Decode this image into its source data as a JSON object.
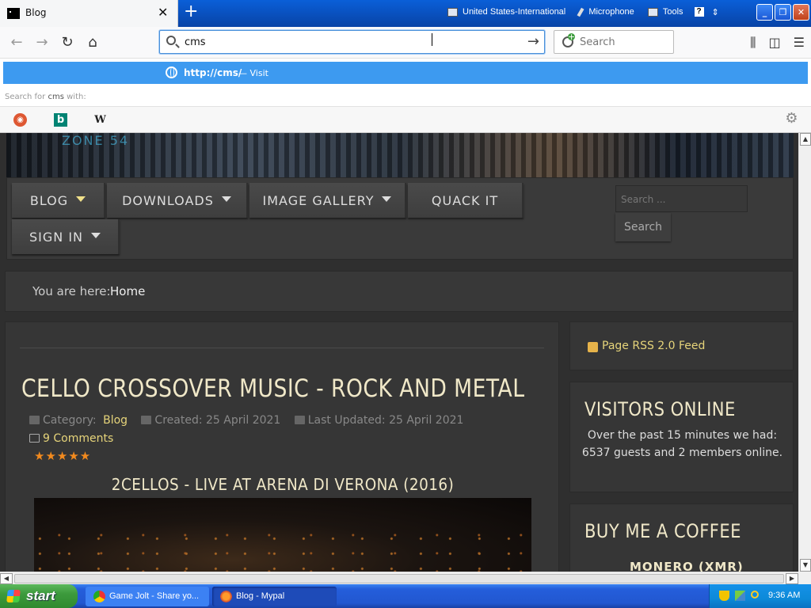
{
  "browser": {
    "tab_title": "Blog",
    "url_value": "cms",
    "search_placeholder": "Search",
    "suggestion_url": "http://cms/",
    "suggestion_action": "— Visit",
    "search_for_prefix": "Search for",
    "search_for_term": "cms",
    "search_for_suffix": "with:"
  },
  "language_bar": {
    "language": "United States-International",
    "microphone": "Microphone",
    "tools": "Tools",
    "help": "?"
  },
  "site": {
    "banner_text": "ZONE 54",
    "menu": {
      "blog": "BLOG",
      "downloads": "DOWNLOADS",
      "image_gallery": "IMAGE GALLERY",
      "quack_it": "QUACK IT",
      "sign_in": "SIGN IN"
    },
    "search_placeholder": "Search ...",
    "search_button": "Search",
    "breadcrumb_label": "You are here:",
    "breadcrumb_home": "Home"
  },
  "article": {
    "title": "CELLO CROSSOVER MUSIC - ROCK AND METAL",
    "category_label": "Category:",
    "category": "Blog",
    "created": "Created: 25 April 2021",
    "updated": "Last Updated: 25 April 2021",
    "comments": "9 Comments",
    "rating": "★★★★★",
    "rating_value": 5,
    "video_title": "2CELLOS - LIVE AT ARENA DI VERONA (2016)"
  },
  "sidebar": {
    "rss": "Page RSS 2.0 Feed",
    "visitors_title": "VISITORS ONLINE",
    "visitors_text": "Over the past 15 minutes we had: 6537 guests and 2 members online.",
    "coffee_title": "BUY ME A COFFEE",
    "coffee_sub": "MONERO (XMR)"
  },
  "taskbar": {
    "start": "start",
    "task1": "Game Jolt - Share yo...",
    "task2": "Blog - Mypal",
    "clock": "9:36 AM"
  }
}
